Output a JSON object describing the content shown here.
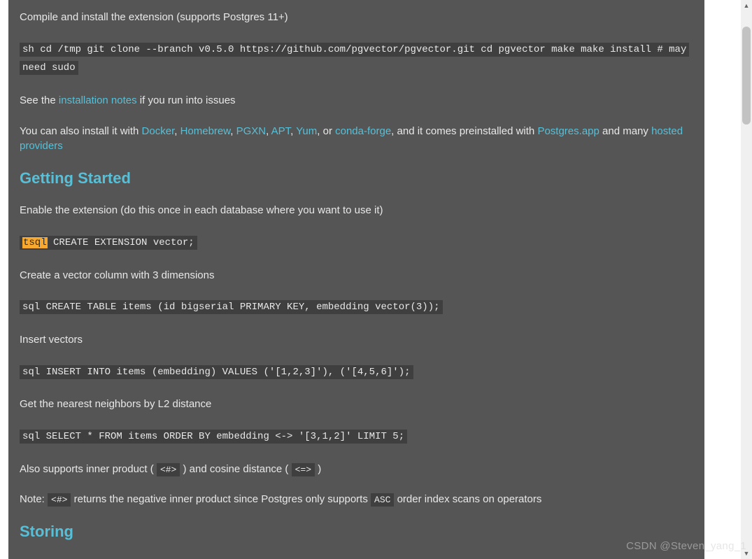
{
  "p_compile": "Compile and install the extension (supports Postgres 11+)",
  "code_install": "sh cd /tmp git clone --branch v0.5.0 https://github.com/pgvector/pgvector.git cd pgvector make make install # may need sudo",
  "p_seethe_a": "See the ",
  "link_install_notes": "installation notes",
  "p_seethe_b": " if you run into issues",
  "p_installwith_a": "You can also install it with ",
  "link_docker": "Docker",
  "link_homebrew": "Homebrew",
  "link_pgxn": "PGXN",
  "link_apt": "APT",
  "link_yum": "Yum",
  "p_installwith_or": ", or ",
  "link_conda": "conda-forge",
  "p_installwith_b": ", and it comes preinstalled with ",
  "link_pgapp": "Postgres.app",
  "p_installwith_c": " and many ",
  "link_hosted": "hosted providers",
  "h_getting_started": "Getting Started",
  "p_enable": "Enable the extension (do this once in each database where you want to use it)",
  "code_tsql_hl": "tsql",
  "code_tsql_rest": " CREATE EXTENSION vector;",
  "p_createcol": "Create a vector column with 3 dimensions",
  "code_create": "sql CREATE TABLE items (id bigserial PRIMARY KEY, embedding vector(3));",
  "p_insert": "Insert vectors",
  "code_insert": "sql INSERT INTO items (embedding) VALUES ('[1,2,3]'), ('[4,5,6]');",
  "p_nearest": "Get the nearest neighbors by L2 distance",
  "code_select": "sql SELECT * FROM items ORDER BY embedding <-> '[3,1,2]' LIMIT 5;",
  "p_also_a": "Also supports inner product (",
  "op_ip": "<#>",
  "p_also_b": ") and cosine distance (",
  "op_cos": "<=>",
  "p_also_c": ")",
  "p_note_a": "Note: ",
  "op_ip2": "<#>",
  "p_note_b": " returns the negative inner product since Postgres only supports ",
  "kw_asc": "ASC",
  "p_note_c": " order index scans on operators",
  "h_storing": "Storing",
  "watermark": "CSDN @Steven_yang_1",
  "sep_comma": ", "
}
